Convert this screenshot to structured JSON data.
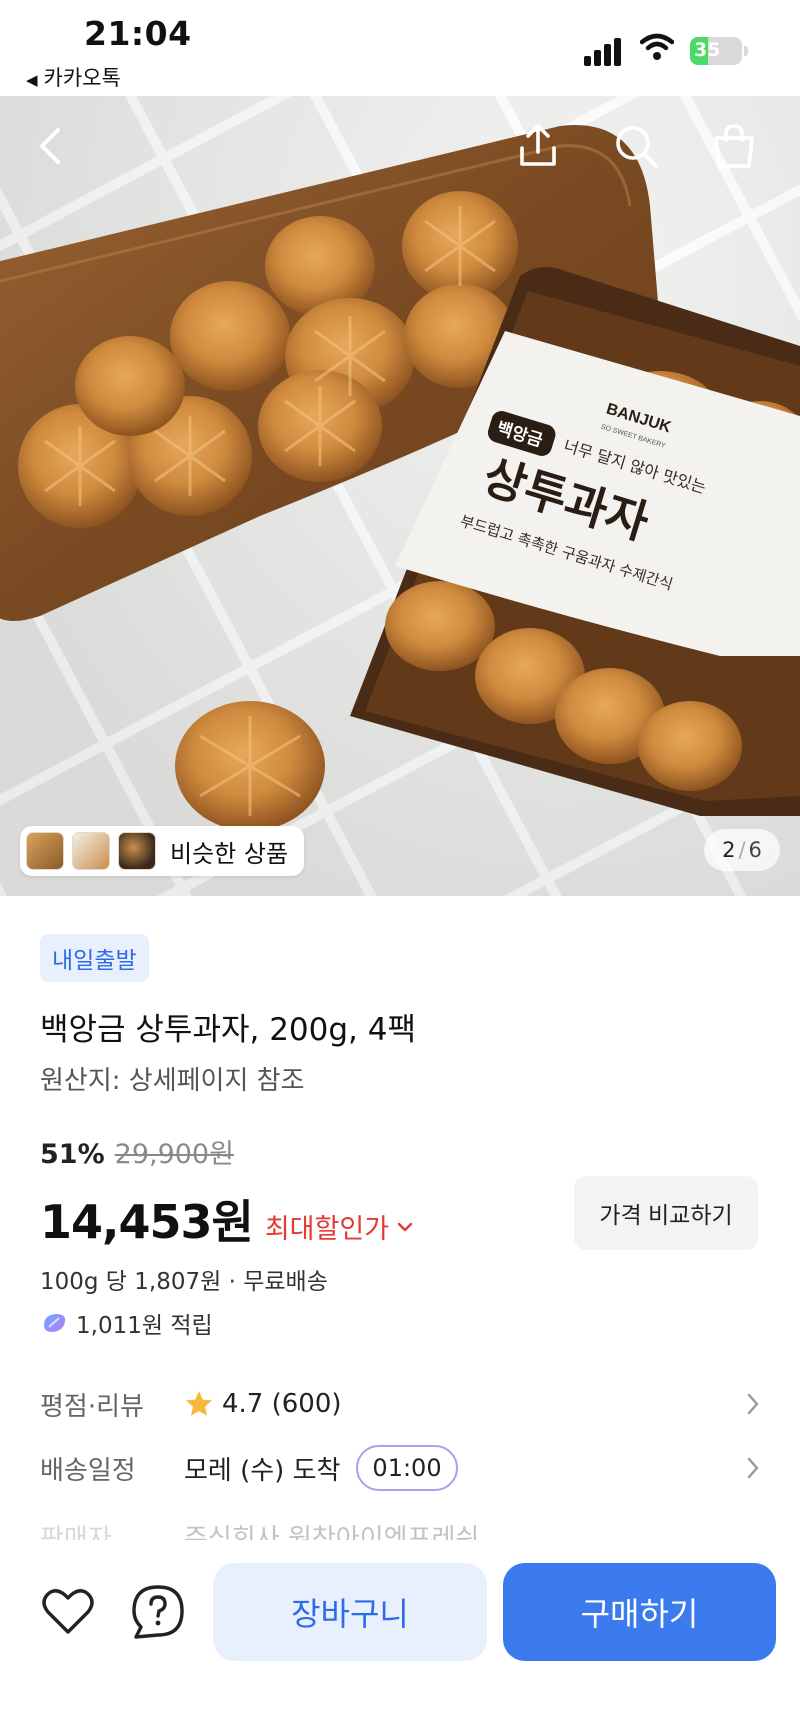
{
  "status_bar": {
    "time": "21:04",
    "back_app": "카카오톡",
    "battery": "35",
    "battery_level": 0.35
  },
  "hero": {
    "similar_label": "비슷한 상품",
    "page_current": "2",
    "page_sep": "/",
    "page_total": "6",
    "package_text_brand": "BANJUK",
    "package_text_brand_sub": "SO SWEET BAKERY",
    "package_text_tag": "백앙금",
    "package_text_tagline": "너무 달지 않아 맛있는",
    "package_text_name": "상투과자",
    "package_text_desc": "부드럽고 촉촉한 구움과자 수제간식"
  },
  "product": {
    "badge": "내일출발",
    "title": "백앙금 상투과자, 200g, 4팩",
    "origin": "원산지: 상세페이지 참조",
    "discount_pct": "51%",
    "original_price": "29,900원",
    "price": "14,453원",
    "max_discount_label": "최대할인가",
    "compare_label": "가격 비교하기",
    "per_unit": "100g 당 1,807원 · 무료배송",
    "points": "1,011원 적립"
  },
  "info": {
    "rating_label": "평점·리뷰",
    "rating_value": "4.7 (600)",
    "delivery_label": "배송일정",
    "delivery_value": "모레 (수) 도착",
    "delivery_time": "01:00",
    "seller_label": "판매자",
    "seller_value": "주식회사 원찬아이엔프레쉬"
  },
  "bottom_bar": {
    "cart_label": "장바구니",
    "buy_label": "구매하기"
  },
  "colors": {
    "accent_blue": "#3b7bed",
    "discount_red": "#e53935",
    "badge_bg": "#e8f0fd"
  }
}
